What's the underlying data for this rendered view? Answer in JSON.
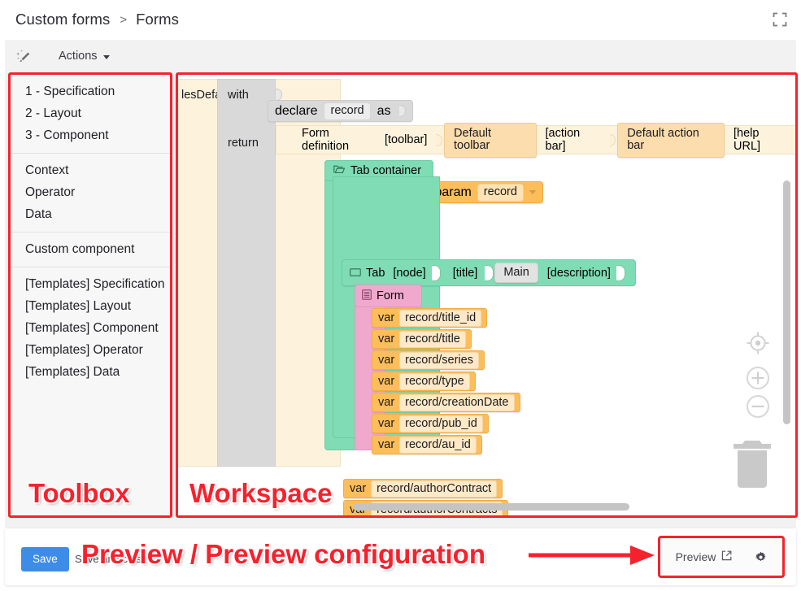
{
  "header": {
    "breadcrumb": [
      "Custom forms",
      "Forms"
    ],
    "separator": ">",
    "fullscreen_icon": "fullscreen-icon"
  },
  "toolbar": {
    "wand_icon": "magic-wand-icon",
    "actions_label": "Actions"
  },
  "toolbox": {
    "annotation": "Toolbox",
    "groups": [
      {
        "items": [
          "1 - Specification",
          "2 - Layout",
          "3 - Component"
        ]
      },
      {
        "items": [
          "Context",
          "Operator",
          "Data"
        ]
      },
      {
        "items": [
          "Custom component"
        ]
      },
      {
        "items": [
          "[Templates] Specification",
          "[Templates] Layout",
          "[Templates] Component",
          "[Templates] Operator",
          "[Templates] Data"
        ]
      }
    ]
  },
  "workspace": {
    "annotation": "Workspace",
    "outer_block_label": "lesDefault",
    "keywords": {
      "with": "with",
      "return": "return"
    },
    "declare": {
      "kw": "declare",
      "field": "record",
      "as": "as"
    },
    "form_param": {
      "label": "form param",
      "value": "record"
    },
    "form_definition": {
      "label": "Form definition",
      "toolbar_label": "[toolbar]",
      "toolbar_value": "Default toolbar",
      "action_bar_label": "[action bar]",
      "action_bar_value": "Default action bar",
      "help_url_label": "[help URL]"
    },
    "tab_container": {
      "icon": "folder-open-icon",
      "label": "Tab container"
    },
    "tab": {
      "icon": "folder-icon",
      "label": "Tab",
      "node_label": "[node]",
      "title_label": "[title]",
      "title_value": "Main",
      "description_label": "[description]"
    },
    "form_block": {
      "icon": "list-icon",
      "label": "Form"
    },
    "var_keyword": "var",
    "form_vars": [
      "record/title_id",
      "record/title",
      "record/series",
      "record/type",
      "record/creationDate",
      "record/pub_id",
      "record/au_id"
    ],
    "outer_vars": [
      "record/authorContract",
      "record/authorContracts"
    ],
    "controls": {
      "center_icon": "center-target-icon",
      "zoom_in_icon": "zoom-in-icon",
      "zoom_out_icon": "zoom-out-icon",
      "trash_icon": "trash-icon",
      "vertical_scrollbar": "vertical-scrollbar",
      "horizontal_scrollbar": "horizontal-scrollbar"
    }
  },
  "footer": {
    "save_label": "Save",
    "save_hint": "Save and close",
    "preview_label": "Preview",
    "preview_external_icon": "external-link-icon",
    "preview_gear_icon": "gear-icon",
    "annotation": "Preview / Preview configuration"
  },
  "colors": {
    "annotation_red": "#f5222d",
    "save_blue": "#3d8ce8",
    "block_orange": "#fcbd5b",
    "block_green": "#7fdcb4",
    "block_pink": "#f0a9cd",
    "block_gray": "#d9d9d9",
    "block_cream": "#fdf3dd"
  }
}
